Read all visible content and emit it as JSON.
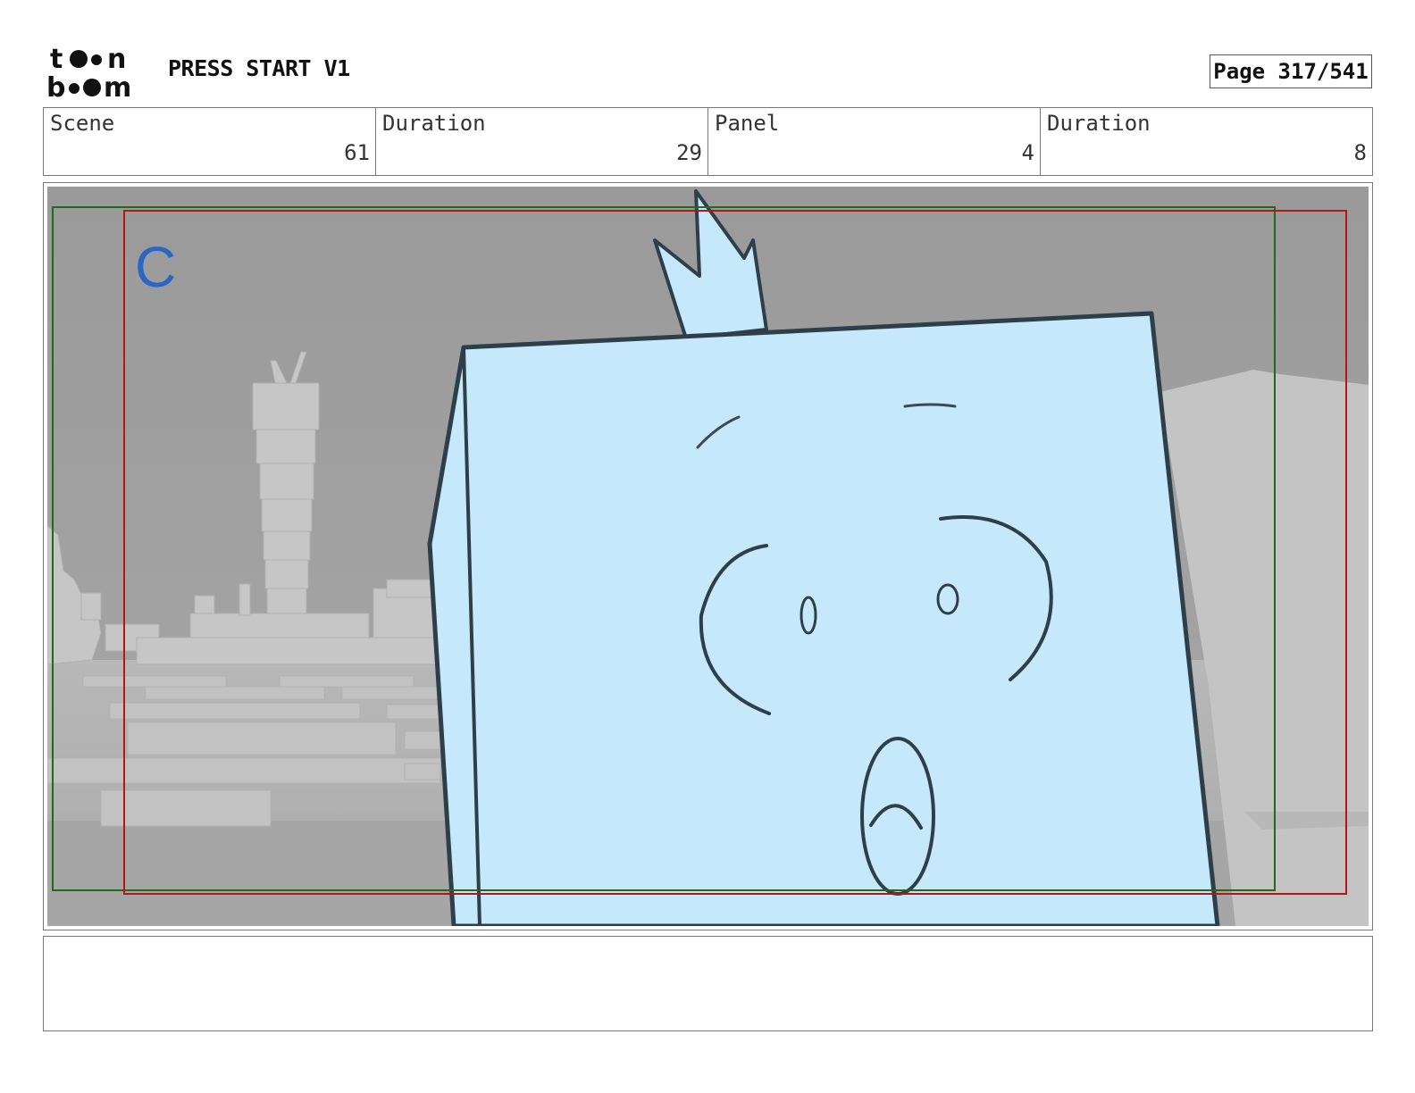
{
  "header": {
    "logo_text": "toon boom",
    "project_title": "PRESS START V1",
    "page_label": "Page 317/541"
  },
  "info": [
    {
      "label": "Scene",
      "value": "61"
    },
    {
      "label": "Duration",
      "value": "29"
    },
    {
      "label": "Panel",
      "value": "4"
    },
    {
      "label": "Duration",
      "value": "8"
    }
  ],
  "panel": {
    "layer_letter": "C",
    "safe_frame_color": "#1e6b1e",
    "camera_frame_color": "#b01818",
    "character_fill": "#c6e8fb",
    "background_gray": "#9e9e9e"
  },
  "notes": {
    "text": ""
  }
}
